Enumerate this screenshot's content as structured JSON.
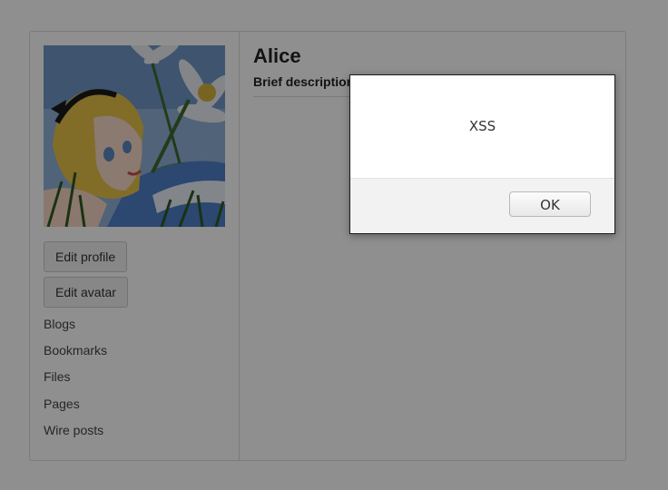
{
  "profile": {
    "name": "Alice",
    "brief_description_label": "Brief description"
  },
  "sidebar": {
    "avatar_alt": "Alice avatar",
    "buttons": {
      "edit_profile": "Edit profile",
      "edit_avatar": "Edit avatar"
    },
    "menu": [
      {
        "label": "Blogs"
      },
      {
        "label": "Bookmarks"
      },
      {
        "label": "Files"
      },
      {
        "label": "Pages"
      },
      {
        "label": "Wire posts"
      }
    ]
  },
  "alert": {
    "message": "XSS",
    "ok_label": "OK"
  }
}
